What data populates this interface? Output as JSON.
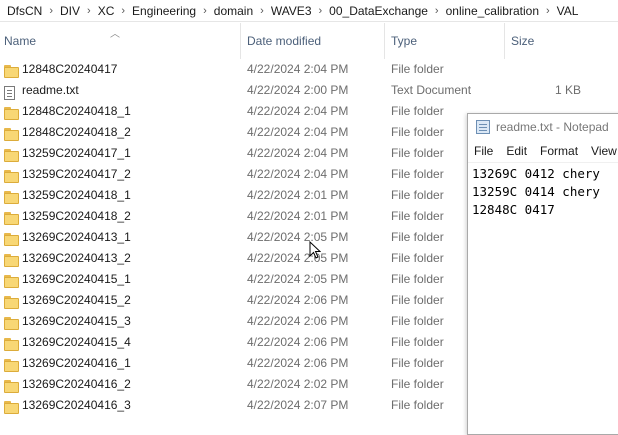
{
  "breadcrumb": [
    "DfsCN",
    "DIV",
    "XC",
    "Engineering",
    "domain",
    "WAVE3",
    "00_DataExchange",
    "online_calibration",
    "VAL"
  ],
  "columns": {
    "name": "Name",
    "date": "Date modified",
    "type": "Type",
    "size": "Size"
  },
  "files": [
    {
      "name": "12848C20240417",
      "date": "4/22/2024 2:04 PM",
      "type": "File folder",
      "size": "",
      "icon": "folder-icon"
    },
    {
      "name": "readme.txt",
      "date": "4/22/2024 2:00 PM",
      "type": "Text Document",
      "size": "1 KB",
      "icon": "text-file-icon"
    },
    {
      "name": "12848C20240418_1",
      "date": "4/22/2024 2:04 PM",
      "type": "File folder",
      "size": "",
      "icon": "folder-icon"
    },
    {
      "name": "12848C20240418_2",
      "date": "4/22/2024 2:04 PM",
      "type": "File folder",
      "size": "",
      "icon": "folder-icon"
    },
    {
      "name": "13259C20240417_1",
      "date": "4/22/2024 2:04 PM",
      "type": "File folder",
      "size": "",
      "icon": "folder-icon"
    },
    {
      "name": "13259C20240417_2",
      "date": "4/22/2024 2:04 PM",
      "type": "File folder",
      "size": "",
      "icon": "folder-icon"
    },
    {
      "name": "13259C20240418_1",
      "date": "4/22/2024 2:01 PM",
      "type": "File folder",
      "size": "",
      "icon": "folder-icon"
    },
    {
      "name": "13259C20240418_2",
      "date": "4/22/2024 2:01 PM",
      "type": "File folder",
      "size": "",
      "icon": "folder-icon"
    },
    {
      "name": "13269C20240413_1",
      "date": "4/22/2024 2:05 PM",
      "type": "File folder",
      "size": "",
      "icon": "folder-icon"
    },
    {
      "name": "13269C20240413_2",
      "date": "4/22/2024 2:05 PM",
      "type": "File folder",
      "size": "",
      "icon": "folder-icon"
    },
    {
      "name": "13269C20240415_1",
      "date": "4/22/2024 2:05 PM",
      "type": "File folder",
      "size": "",
      "icon": "folder-icon"
    },
    {
      "name": "13269C20240415_2",
      "date": "4/22/2024 2:06 PM",
      "type": "File folder",
      "size": "",
      "icon": "folder-icon"
    },
    {
      "name": "13269C20240415_3",
      "date": "4/22/2024 2:06 PM",
      "type": "File folder",
      "size": "",
      "icon": "folder-icon"
    },
    {
      "name": "13269C20240415_4",
      "date": "4/22/2024 2:06 PM",
      "type": "File folder",
      "size": "",
      "icon": "folder-icon"
    },
    {
      "name": "13269C20240416_1",
      "date": "4/22/2024 2:06 PM",
      "type": "File folder",
      "size": "",
      "icon": "folder-icon"
    },
    {
      "name": "13269C20240416_2",
      "date": "4/22/2024 2:02 PM",
      "type": "File folder",
      "size": "",
      "icon": "folder-icon"
    },
    {
      "name": "13269C20240416_3",
      "date": "4/22/2024 2:07 PM",
      "type": "File folder",
      "size": "",
      "icon": "folder-icon"
    }
  ],
  "notepad": {
    "title": "readme.txt - Notepad",
    "menu": [
      "File",
      "Edit",
      "Format",
      "View"
    ],
    "lines": [
      "13269C 0412 chery",
      "13259C 0414 chery",
      "12848C 0417"
    ]
  },
  "colors": {
    "folder": "#f8d775",
    "header_text": "#4c607a",
    "secondary_text": "#6d6d6d"
  }
}
